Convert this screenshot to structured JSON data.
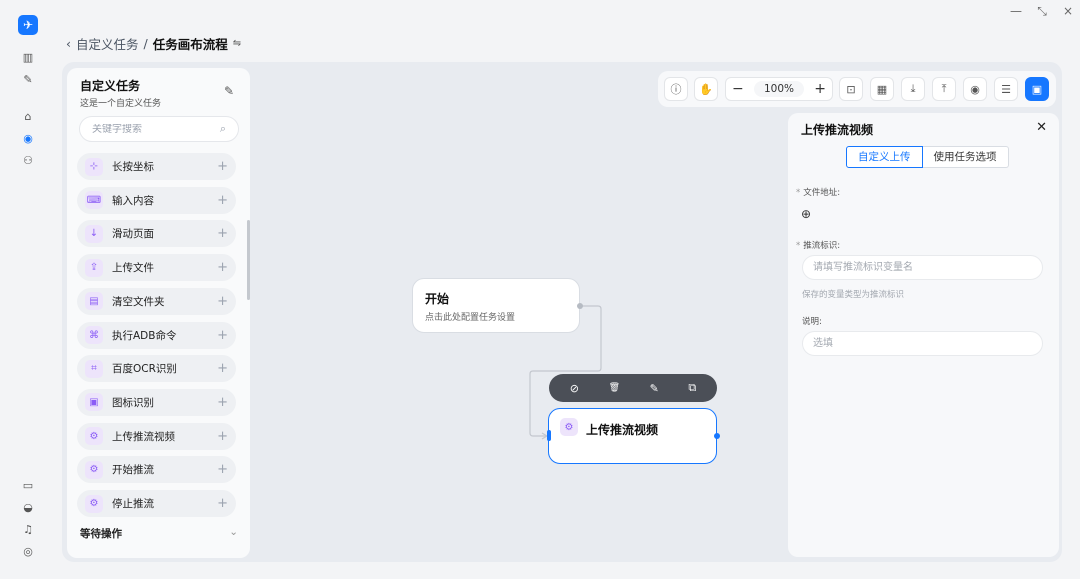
{
  "window": {
    "minimize_glyph": "—",
    "restore_glyph": "⤡",
    "close_glyph": "×"
  },
  "rail": {
    "logo_icon": "app-logo-icon",
    "top_icons": [
      "sidebar-toggle-icon",
      "edit-square-icon",
      "home-icon",
      "task-flow-icon",
      "users-icon"
    ],
    "bottom_icons": [
      "wallet-icon",
      "theme-icon",
      "bell-icon",
      "user-profile-icon"
    ],
    "active_icon": "task-flow-icon"
  },
  "breadcrumb": {
    "back_glyph": "‹",
    "parent": "自定义任务",
    "separator": "/",
    "current": "任务画布流程",
    "swap_glyph": "⇋"
  },
  "left_panel": {
    "title": "自定义任务",
    "description": "这是一个自定义任务",
    "edit_glyph": "✎",
    "search_placeholder": "关键字搜索",
    "search_glyph": "⌕",
    "items": [
      {
        "label": "长按坐标",
        "icon": "long-press-icon",
        "glyph": "⊹"
      },
      {
        "label": "输入内容",
        "icon": "input-icon",
        "glyph": "⌨"
      },
      {
        "label": "滑动页面",
        "icon": "swipe-icon",
        "glyph": "↓"
      },
      {
        "label": "上传文件",
        "icon": "upload-icon",
        "glyph": "⇪"
      },
      {
        "label": "清空文件夹",
        "icon": "clear-folder-icon",
        "glyph": "▤"
      },
      {
        "label": "执行ADB命令",
        "icon": "terminal-icon",
        "glyph": "⌘"
      },
      {
        "label": "百度OCR识别",
        "icon": "scan-icon",
        "glyph": "⌗"
      },
      {
        "label": "图标识别",
        "icon": "image-recognize-icon",
        "glyph": "▣"
      },
      {
        "label": "上传推流视频",
        "icon": "gear-icon",
        "glyph": "⚙"
      },
      {
        "label": "开始推流",
        "icon": "gear-icon",
        "glyph": "⚙"
      },
      {
        "label": "停止推流",
        "icon": "gear-icon",
        "glyph": "⚙"
      }
    ],
    "plus_glyph": "+",
    "section": {
      "label": "等待操作",
      "glyph": "⌄"
    }
  },
  "toolbar": {
    "buttons_left": [
      {
        "name": "info-icon",
        "glyph": "ⓘ"
      },
      {
        "name": "hand-pan-icon",
        "glyph": "✋"
      }
    ],
    "zoom": {
      "minus": "−",
      "value": "100%",
      "plus": "+"
    },
    "buttons_right": [
      {
        "name": "fit-view-icon",
        "glyph": "⊡"
      },
      {
        "name": "grid-icon",
        "glyph": "▦"
      },
      {
        "name": "download-icon",
        "glyph": "⤓"
      },
      {
        "name": "upload-icon",
        "glyph": "⤒"
      },
      {
        "name": "play-icon",
        "glyph": "◉"
      },
      {
        "name": "list-icon",
        "glyph": "☰"
      },
      {
        "name": "save-icon",
        "glyph": "▣"
      }
    ]
  },
  "canvas": {
    "start_node": {
      "title": "开始",
      "description": "点击此处配置任务设置"
    },
    "node_actions": [
      {
        "name": "disable-icon",
        "glyph": "⊘"
      },
      {
        "name": "delete-icon",
        "glyph": "🗑"
      },
      {
        "name": "edit-icon",
        "glyph": "✎"
      },
      {
        "name": "copy-icon",
        "glyph": "⧉"
      }
    ],
    "selected_node": {
      "title": "上传推流视频",
      "icon": "gear-icon",
      "glyph": "⚙"
    }
  },
  "props_panel": {
    "title": "上传推流视频",
    "close_glyph": "✕",
    "tabs": [
      {
        "label": "自定义上传",
        "active": true
      },
      {
        "label": "使用任务选项",
        "active": false
      }
    ],
    "file_label": "文件地址:",
    "add_glyph": "⊕",
    "stream_label": "推流标识:",
    "stream_placeholder": "请填写推流标识变量名",
    "stream_hint": "保存的变量类型为推流标识",
    "note_label": "说明:",
    "note_placeholder": "选填",
    "required_glyph": "*"
  },
  "colors": {
    "accent": "#1677ff",
    "icon_purple": "#8b5cf6",
    "node_bar": "#4b4f57"
  }
}
